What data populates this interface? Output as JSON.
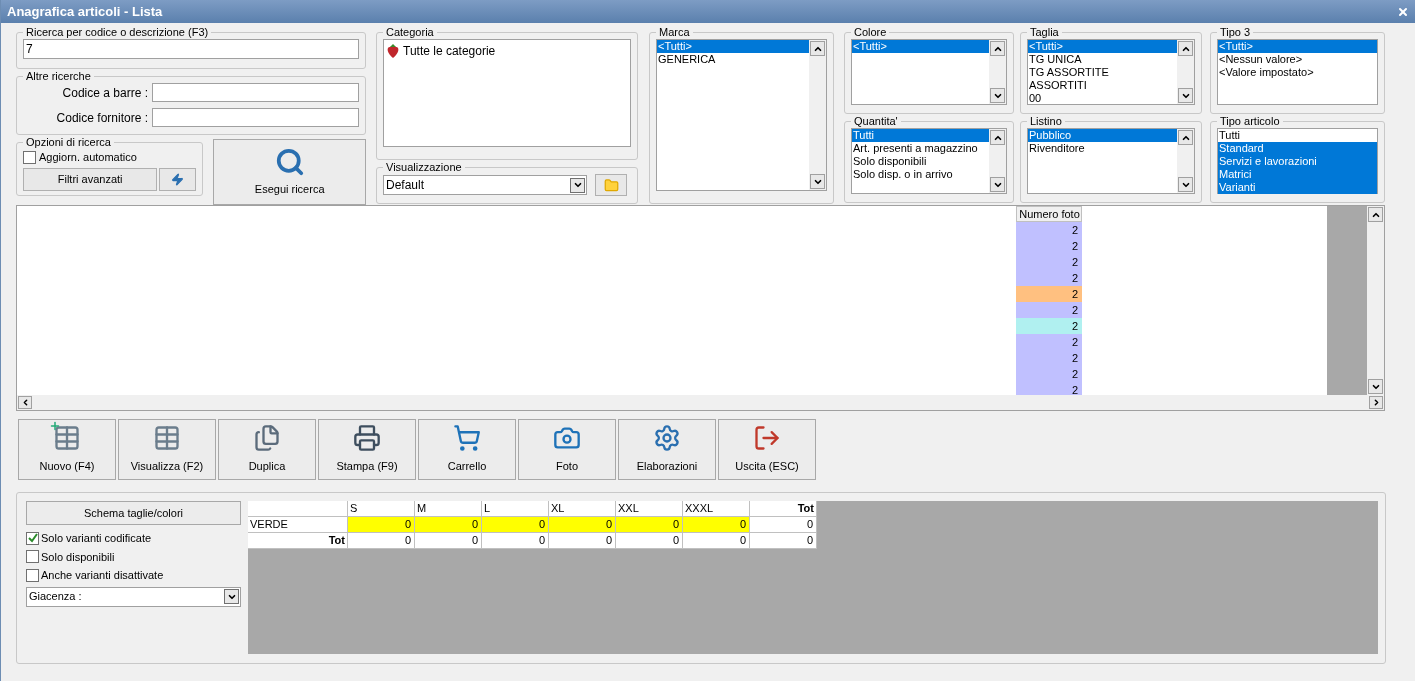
{
  "window": {
    "title": "Anagrafica articoli  - Lista"
  },
  "search": {
    "title": "Ricerca per codice o descrizione (F3)",
    "value": "7"
  },
  "other_searches": {
    "title": "Altre ricerche",
    "fields": [
      {
        "label": "Codice a barre :"
      },
      {
        "label": "Codice fornitore :"
      }
    ]
  },
  "search_options": {
    "title": "Opzioni di ricerca",
    "auto_update": {
      "label": "Aggiorn. automatico",
      "checked": false
    },
    "advanced_filters": "Filtri avanzati"
  },
  "run_search": "Esegui ricerca",
  "category": {
    "title": "Categoria",
    "items": [
      {
        "label": "Tutte le categorie"
      }
    ]
  },
  "view": {
    "title": "Visualizzazione",
    "value": "Default"
  },
  "filters": [
    {
      "title": "Marca",
      "items": [
        {
          "label": "<Tutti>",
          "selected": true
        },
        {
          "label": "GENERICA",
          "selected": false
        }
      ]
    },
    {
      "title": "Colore",
      "items": [
        {
          "label": "<Tutti>",
          "selected": true
        }
      ]
    },
    {
      "title": "Quantita'",
      "items": [
        {
          "label": "Tutti",
          "selected": true
        },
        {
          "label": "Art. presenti a magazzino",
          "selected": false
        },
        {
          "label": "Solo disponibili",
          "selected": false
        },
        {
          "label": "Solo disp. o in arrivo",
          "selected": false
        }
      ]
    },
    {
      "title": "Taglia",
      "items": [
        {
          "label": "<Tutti>",
          "selected": true
        },
        {
          "label": "TG UNICA",
          "selected": false
        },
        {
          "label": "TG ASSORTITE",
          "selected": false
        },
        {
          "label": "ASSORTITI",
          "selected": false
        },
        {
          "label": "00",
          "selected": false
        }
      ]
    },
    {
      "title": "Listino",
      "items": [
        {
          "label": "Pubblico",
          "selected": true
        },
        {
          "label": "Rivenditore",
          "selected": false
        }
      ]
    },
    {
      "title": "Tipo 3",
      "items": [
        {
          "label": "<Tutti>",
          "selected": true
        },
        {
          "label": "<Nessun valore>",
          "selected": false
        },
        {
          "label": "<Valore impostato>",
          "selected": false
        }
      ]
    },
    {
      "title": "Tipo articolo",
      "items": [
        {
          "label": "Tutti",
          "selected": false
        },
        {
          "label": "Standard",
          "selected": true
        },
        {
          "label": "Servizi e lavorazioni",
          "selected": true
        },
        {
          "label": "Matrici",
          "selected": true
        },
        {
          "label": "Varianti",
          "selected": true
        }
      ]
    }
  ],
  "grid": {
    "columns": [
      "Numero foto"
    ],
    "rows": [
      {
        "values": [
          "2"
        ],
        "color": "#c0c0ff"
      },
      {
        "values": [
          "2"
        ],
        "color": "#c0c0ff"
      },
      {
        "values": [
          "2"
        ],
        "color": "#c0c0ff"
      },
      {
        "values": [
          "2"
        ],
        "color": "#c0c0ff"
      },
      {
        "values": [
          "2"
        ],
        "color": "#ffc080"
      },
      {
        "values": [
          "2"
        ],
        "color": "#c0c0ff"
      },
      {
        "values": [
          "2"
        ],
        "color": "#b0f0f0"
      },
      {
        "values": [
          "2"
        ],
        "color": "#c0c0ff"
      },
      {
        "values": [
          "2"
        ],
        "color": "#c0c0ff"
      },
      {
        "values": [
          "2"
        ],
        "color": "#c0c0ff"
      },
      {
        "values": [
          "2"
        ],
        "color": "#c0c0ff"
      }
    ]
  },
  "toolbar": [
    {
      "label": "Nuovo (F4)",
      "kind": "new"
    },
    {
      "label": "Visualizza (F2)",
      "kind": "view"
    },
    {
      "label": "Duplica",
      "kind": "duplicate"
    },
    {
      "label": "Stampa (F9)",
      "kind": "print"
    },
    {
      "label": "Carrello",
      "kind": "cart"
    },
    {
      "label": "Foto",
      "kind": "photo"
    },
    {
      "label": "Elaborazioni",
      "kind": "process"
    },
    {
      "label": "Uscita (ESC)",
      "kind": "exit"
    }
  ],
  "variants": {
    "scheme_button": "Schema taglie/colori",
    "options": [
      {
        "label": "Solo varianti codificate",
        "checked": true
      },
      {
        "label": "Solo disponibili",
        "checked": false
      },
      {
        "label": "Anche varianti disattivate",
        "checked": false
      }
    ],
    "stock": {
      "label": "Giacenza :"
    },
    "table": {
      "columns": [
        "S",
        "M",
        "L",
        "XL",
        "XXL",
        "XXXL",
        "Tot"
      ],
      "rows": [
        {
          "kind": "data",
          "label": "VERDE",
          "values": [
            "0",
            "0",
            "0",
            "0",
            "0",
            "0",
            "0"
          ]
        },
        {
          "kind": "total",
          "label": "Tot",
          "values": [
            "0",
            "0",
            "0",
            "0",
            "0",
            "0",
            "0"
          ]
        }
      ]
    }
  }
}
